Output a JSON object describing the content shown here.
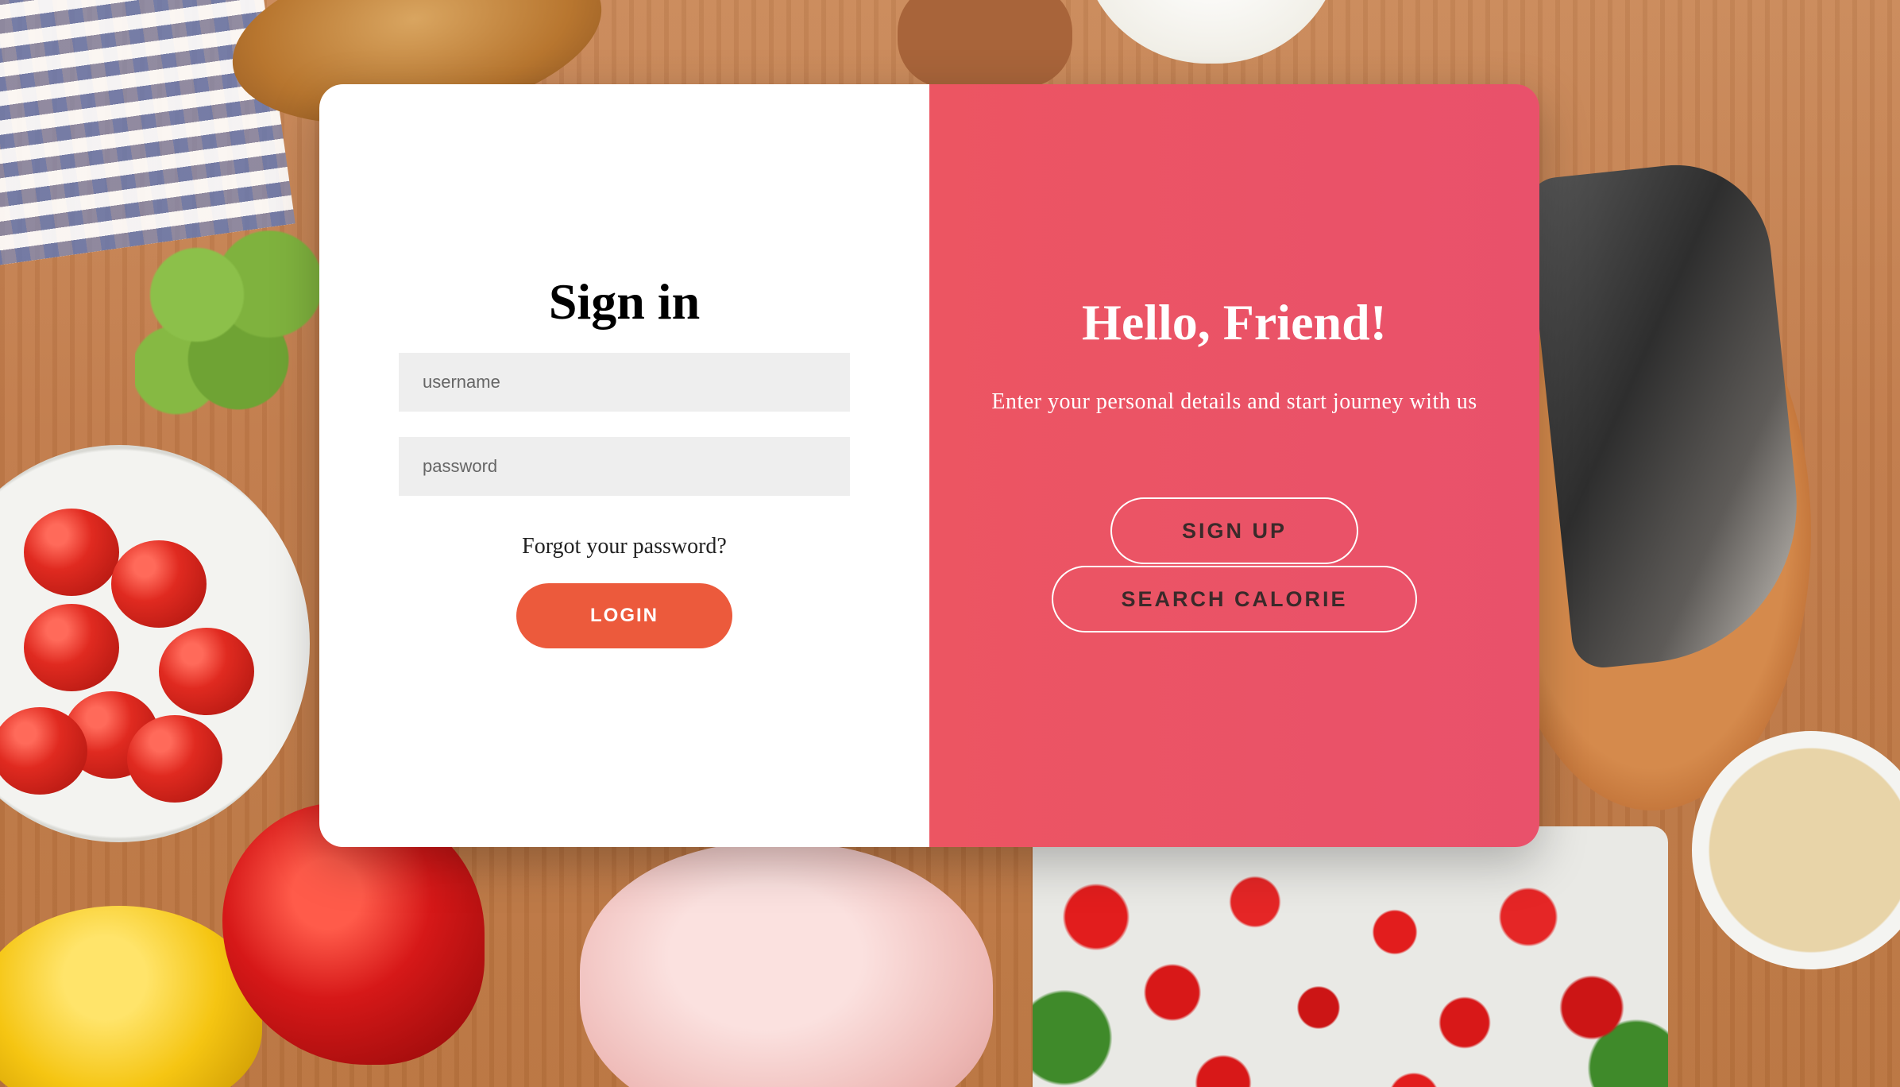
{
  "signin": {
    "title": "Sign in",
    "username_placeholder": "username",
    "password_placeholder": "password",
    "forgot_label": "Forgot your password?",
    "login_label": "LOGIN"
  },
  "welcome": {
    "title": "Hello, Friend!",
    "message": "Enter your personal details and start journey with us",
    "signup_label": "SIGN UP",
    "search_calorie_label": "SEARCH CALORIE"
  },
  "colors": {
    "accent_panel": "#ec5562",
    "login_button": "#ec5a3c",
    "input_background": "#eeeeee"
  }
}
